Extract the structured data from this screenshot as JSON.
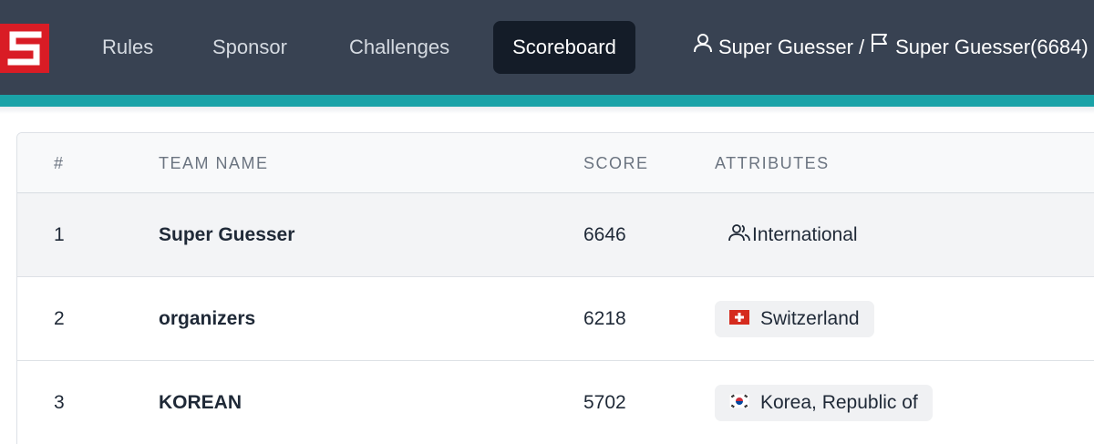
{
  "nav": {
    "logo_letter": "S",
    "links": [
      "Rules",
      "Sponsor",
      "Challenges",
      "Scoreboard"
    ],
    "active": "Scoreboard"
  },
  "user": {
    "user_name": "Super Guesser",
    "separator": "/",
    "team_label": "Super Guesser(6684)"
  },
  "table": {
    "headers": [
      "#",
      "TEAM NAME",
      "SCORE",
      "ATTRIBUTES"
    ],
    "rows": [
      {
        "rank": "1",
        "team": "Super Guesser",
        "score": "6646",
        "attribute": "International",
        "attr_icon": "users-icon"
      },
      {
        "rank": "2",
        "team": "organizers",
        "score": "6218",
        "attribute": "Switzerland",
        "attr_icon": "swiss-flag-icon"
      },
      {
        "rank": "3",
        "team": "KOREAN",
        "score": "5702",
        "attribute": "Korea, Republic of",
        "attr_icon": "korea-flag-icon"
      }
    ]
  },
  "colors": {
    "navbar": "#384252",
    "accent_bar": "#1aa2a7",
    "logo": "#d91c25",
    "active_nav": "#141c28"
  }
}
